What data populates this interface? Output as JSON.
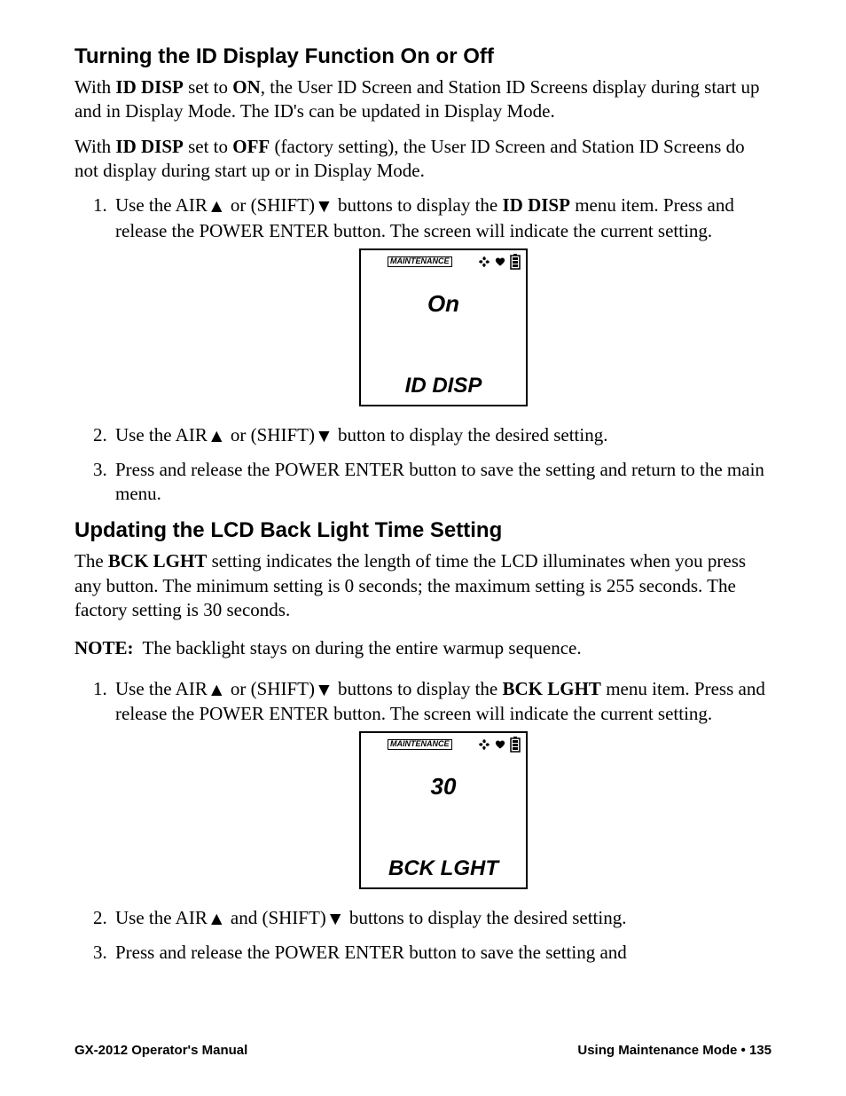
{
  "section1": {
    "heading": "Turning the ID Display Function On or Off",
    "p1_a": "With ",
    "p1_b": "ID DISP",
    "p1_c": " set to ",
    "p1_d": "ON",
    "p1_e": ", the User ID Screen and Station ID Screens display during start up and in Display Mode. The ID's can be updated in Display Mode.",
    "p2_a": "With ",
    "p2_b": "ID DISP",
    "p2_c": " set to ",
    "p2_d": "OFF",
    "p2_e": " (factory setting), the User ID Screen and Station ID Screens do not display during start up or in Display Mode.",
    "li1_a": "Use the AIR",
    "li1_b": " or (SHIFT)",
    "li1_c": " buttons to display the ",
    "li1_d": "ID DISP",
    "li1_e": " menu item. Press and release the POWER ENTER button. The screen will indicate the current setting.",
    "li2_a": "Use the AIR",
    "li2_b": " or (SHIFT)",
    "li2_c": " button to display the desired setting.",
    "li3": "Press and release the POWER ENTER button to save the setting and return to the main menu."
  },
  "lcd1": {
    "maint": "MAINTENANCE",
    "value": "On",
    "label": "ID DISP"
  },
  "section2": {
    "heading": "Updating the LCD Back Light Time Setting",
    "p1_a": "The ",
    "p1_b": "BCK LGHT",
    "p1_c": " setting indicates the length of the time the LCD illuminates when you press any button. The minimum setting is 0 seconds; the maximum setting is 255 seconds. The factory setting is 30 seconds.",
    "p1_full": "The BCK LGHT setting indicates the length of time the LCD illuminates when you press any button. The minimum setting is 0 seconds; the maximum setting is 255 seconds. The factory setting is 30 seconds.",
    "note_label": "NOTE:",
    "note_text": "The backlight stays on during the entire warmup sequence.",
    "li1_a": "Use the AIR",
    "li1_b": " or (SHIFT)",
    "li1_c": " buttons to display the ",
    "li1_d": "BCK LGHT",
    "li1_e": " menu item. Press and release the POWER ENTER button. The screen will indicate the current setting.",
    "li2_a": "Use the AIR",
    "li2_b": " and (SHIFT)",
    "li2_c": " buttons to display the desired setting.",
    "li3": "Press and release the POWER ENTER button to save the setting and"
  },
  "lcd2": {
    "maint": "MAINTENANCE",
    "value": "30",
    "label": "BCK LGHT"
  },
  "footer": {
    "left": "GX-2012 Operator's Manual",
    "right": "Using Maintenance Mode • 135"
  }
}
